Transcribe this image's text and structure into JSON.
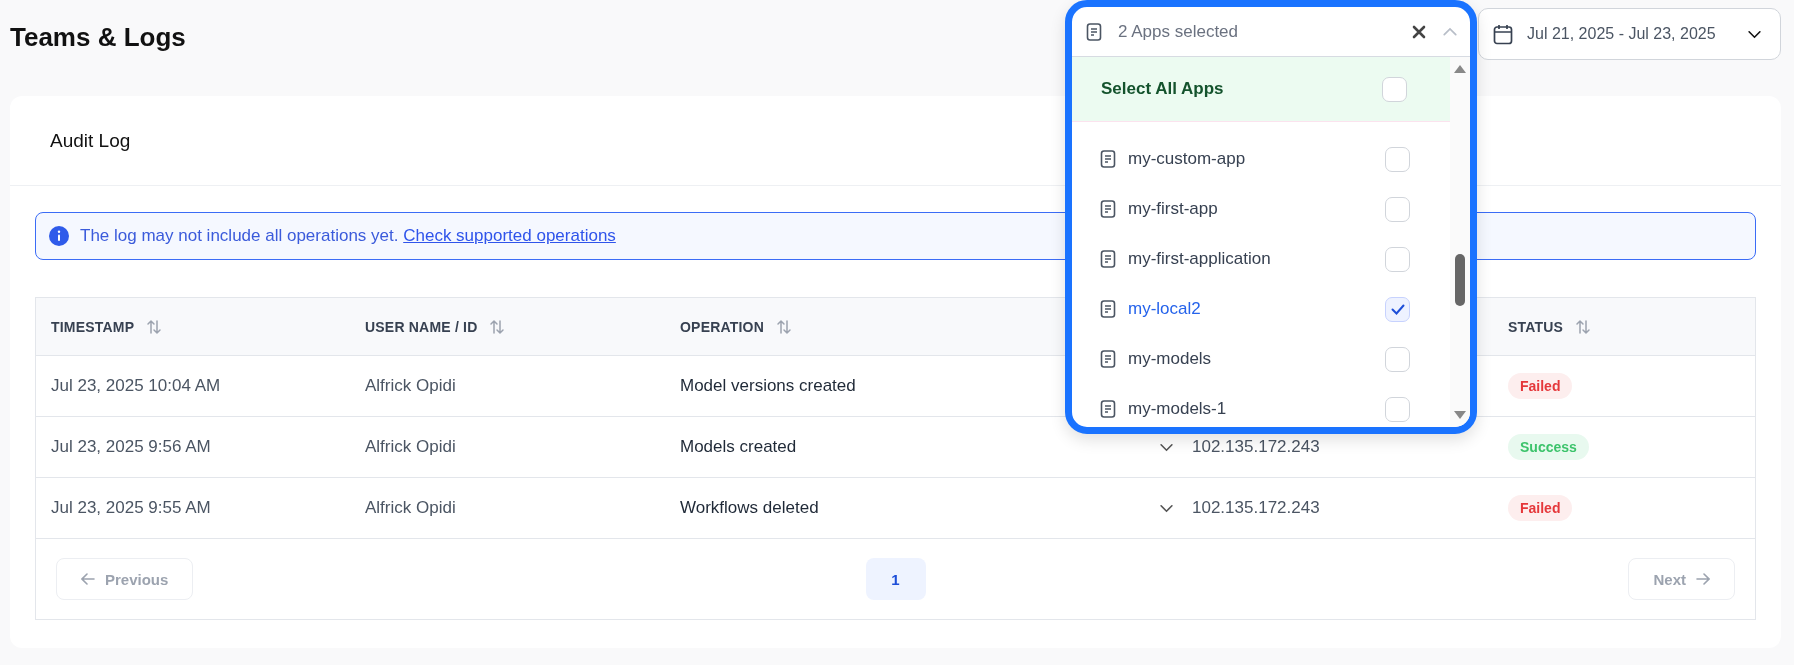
{
  "page": {
    "title": "Teams & Logs"
  },
  "app_filter": {
    "value": "2 Apps selected",
    "expanded": true,
    "select_all": {
      "label": "Select All Apps",
      "checked": false
    },
    "items": [
      {
        "label": "my-custom-app",
        "selected": false
      },
      {
        "label": "my-first-app",
        "selected": false
      },
      {
        "label": "my-first-application",
        "selected": false
      },
      {
        "label": "my-local2",
        "selected": true
      },
      {
        "label": "my-models",
        "selected": false
      },
      {
        "label": "my-models-1",
        "selected": false
      }
    ]
  },
  "date_range": {
    "value": "Jul 21, 2025 - Jul 23, 2025"
  },
  "card": {
    "title": "Audit Log"
  },
  "notice": {
    "text": "The log may not include all operations yet.",
    "link": "Check supported operations"
  },
  "table": {
    "columns": [
      {
        "label": "TIMESTAMP"
      },
      {
        "label": "USER NAME / ID"
      },
      {
        "label": "OPERATION"
      },
      {
        "label": "STATUS"
      }
    ],
    "rows": [
      {
        "timestamp": "Jul 23, 2025 10:04 AM",
        "user": "Alfrick Opidi",
        "operation": "Model versions created",
        "status": {
          "label": "Failed",
          "kind": "failed"
        }
      },
      {
        "timestamp": "Jul 23, 2025 9:56 AM",
        "user": "Alfrick Opidi",
        "operation": "Models created",
        "ip": "102.135.172.243",
        "status": {
          "label": "Success",
          "kind": "success"
        }
      },
      {
        "timestamp": "Jul 23, 2025 9:55 AM",
        "user": "Alfrick Opidi",
        "operation": "Workflows deleted",
        "ip": "102.135.172.243",
        "status": {
          "label": "Failed",
          "kind": "failed"
        }
      }
    ]
  },
  "pagination": {
    "previous": {
      "label": "Previous",
      "disabled": true
    },
    "pages": [
      {
        "label": "1",
        "selected": true
      }
    ],
    "next": {
      "label": "Next",
      "disabled": true
    }
  }
}
